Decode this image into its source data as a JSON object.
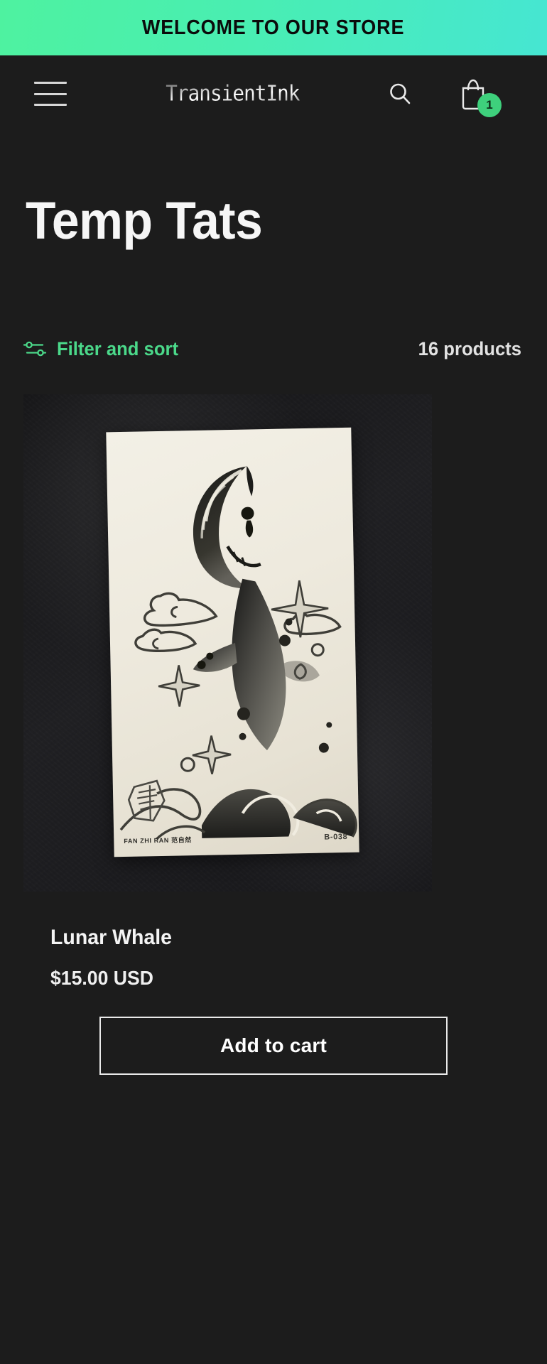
{
  "announcement": {
    "text": "WELCOME TO OUR STORE",
    "bg_gradient_from": "#4ef2a0",
    "bg_gradient_to": "#46e6d2"
  },
  "header": {
    "menu_icon": "hamburger-menu-icon",
    "brand": "TransientInk",
    "search_icon": "search-icon",
    "cart_icon": "shopping-bag-icon",
    "cart_count": "1",
    "cart_badge_color": "#3ed07c"
  },
  "page": {
    "title": "Temp Tats"
  },
  "toolbar": {
    "filter_icon": "sliders-icon",
    "filter_label": "Filter and sort",
    "filter_color": "#4bd98a",
    "product_count": "16 products"
  },
  "products": [
    {
      "title": "Lunar Whale",
      "price": "$15.00 USD",
      "add_to_cart_label": "Add to cart",
      "image_alt": "lunar-whale-temporary-tattoo-sheet",
      "sheet_credit": "FAN ZHI RAN  范自然",
      "sheet_code": "B-038"
    }
  ]
}
